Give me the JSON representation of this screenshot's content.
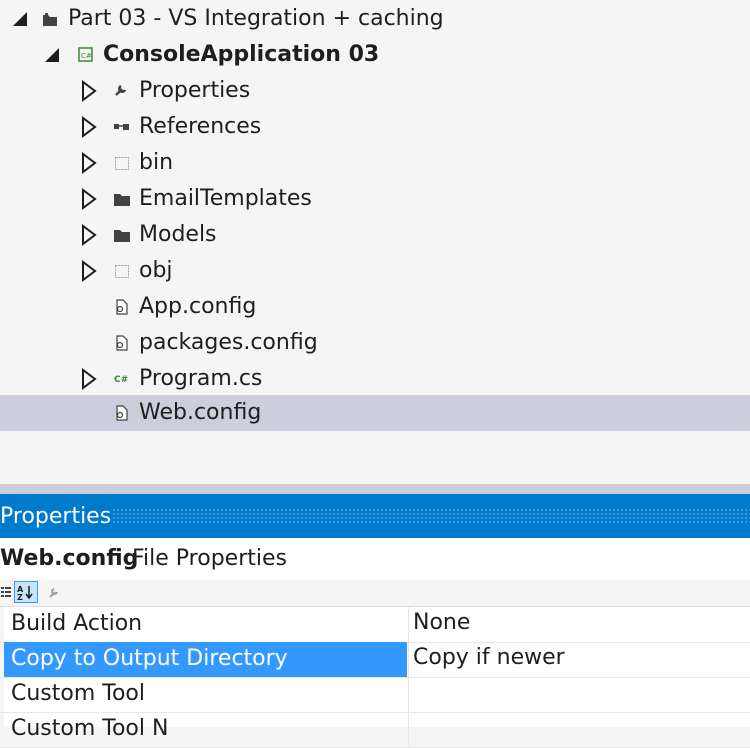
{
  "solution_explorer": {
    "items": [
      {
        "label": "Part 03 - VS Integration + caching",
        "icon": "project-folder-icon",
        "expander": "expanded"
      },
      {
        "label": "ConsoleApplication 03",
        "icon": "csharp-project-icon",
        "expander": "expanded"
      },
      {
        "label": "Properties",
        "icon": "wrench-icon",
        "expander": "collapsed"
      },
      {
        "label": "References",
        "icon": "references-icon",
        "expander": "collapsed"
      },
      {
        "label": "bin",
        "icon": "hidden-folder-icon",
        "expander": "collapsed"
      },
      {
        "label": "EmailTemplates",
        "icon": "folder-icon",
        "expander": "collapsed"
      },
      {
        "label": "Models",
        "icon": "folder-icon",
        "expander": "collapsed"
      },
      {
        "label": "obj",
        "icon": "hidden-folder-icon",
        "expander": "collapsed"
      },
      {
        "label": "App.config",
        "icon": "config-file-icon",
        "expander": "none"
      },
      {
        "label": "packages.config",
        "icon": "config-file-icon",
        "expander": "none"
      },
      {
        "label": "Program.cs",
        "icon": "csharp-file-icon",
        "expander": "collapsed"
      },
      {
        "label": "Web.config",
        "icon": "config-file-icon",
        "expander": "none",
        "selected": true
      }
    ]
  },
  "properties": {
    "title": "Properties",
    "object_name": "Web.config",
    "object_type": "File Properties",
    "toolbar": [
      "categorized-icon",
      "alphabetical-icon",
      "property-pages-icon"
    ],
    "rows": [
      {
        "name": "Build Action",
        "value": "None"
      },
      {
        "name": "Copy to Output Directory",
        "value": "Copy if newer",
        "selected": true
      },
      {
        "name": "Custom Tool",
        "value": ""
      },
      {
        "name": "Custom Tool N",
        "value": ""
      }
    ]
  },
  "colors": {
    "accent": "#007acc",
    "selection_inactive": "#cccedb",
    "selection_active": "#3399ff"
  }
}
